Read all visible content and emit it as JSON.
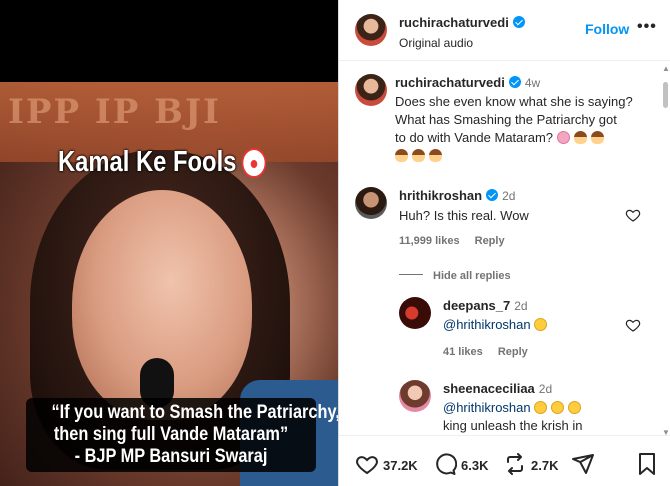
{
  "video": {
    "background_text": "IPP IP BJI",
    "overlay_title": "Kamal Ke Fools",
    "quote_lines": [
      "“If you want to Smash the Patriarchy,",
      "then sing full Vande Mataram”",
      "- BJP MP Bansuri Swaraj"
    ]
  },
  "header": {
    "username": "ruchirachaturvedi",
    "subtitle": "Original audio",
    "follow_label": "Follow",
    "more_label": "•••"
  },
  "comments": [
    {
      "username": "ruchirachaturvedi",
      "time": "4w",
      "lines": [
        "Does she even know what she is saying?",
        "What has Smashing the Patriarchy got",
        "to do with Vande Mataram?"
      ]
    },
    {
      "username": "hrithikroshan",
      "time": "2d",
      "text": "Huh? Is this real. Wow",
      "likes": "11,999 likes",
      "reply_label": "Reply"
    }
  ],
  "hide_replies_label": "Hide all replies",
  "replies": [
    {
      "username": "deepans_7",
      "time": "2d",
      "mention": "@hrithikroshan",
      "likes": "41 likes",
      "reply_label": "Reply"
    },
    {
      "username": "sheenaceciliaa",
      "time": "2d",
      "mention": "@hrithikroshan",
      "text": "king unleash the krish in"
    }
  ],
  "actions": {
    "likes": "37.2K",
    "comments": "6.3K",
    "reposts": "2.7K"
  },
  "colors": {
    "accent": "#0095f6",
    "text": "#262626",
    "muted": "#737373"
  }
}
